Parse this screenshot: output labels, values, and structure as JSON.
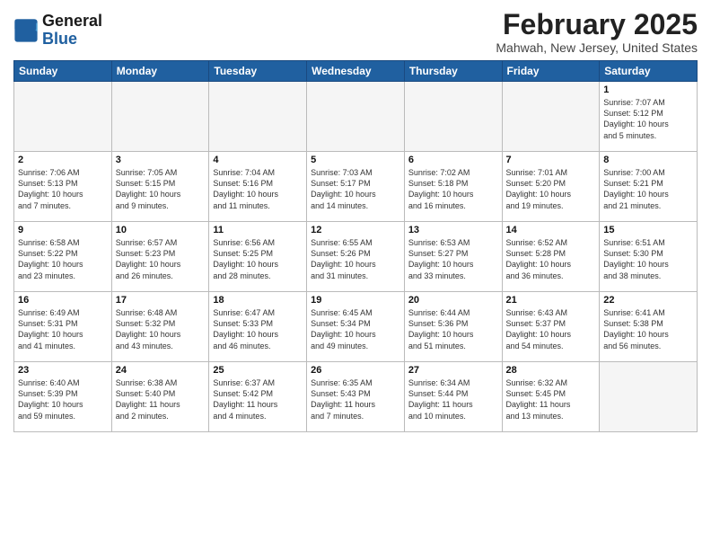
{
  "header": {
    "logo_general": "General",
    "logo_blue": "Blue",
    "title": "February 2025",
    "subtitle": "Mahwah, New Jersey, United States"
  },
  "days_of_week": [
    "Sunday",
    "Monday",
    "Tuesday",
    "Wednesday",
    "Thursday",
    "Friday",
    "Saturday"
  ],
  "weeks": [
    [
      {
        "day": "",
        "info": ""
      },
      {
        "day": "",
        "info": ""
      },
      {
        "day": "",
        "info": ""
      },
      {
        "day": "",
        "info": ""
      },
      {
        "day": "",
        "info": ""
      },
      {
        "day": "",
        "info": ""
      },
      {
        "day": "1",
        "info": "Sunrise: 7:07 AM\nSunset: 5:12 PM\nDaylight: 10 hours\nand 5 minutes."
      }
    ],
    [
      {
        "day": "2",
        "info": "Sunrise: 7:06 AM\nSunset: 5:13 PM\nDaylight: 10 hours\nand 7 minutes."
      },
      {
        "day": "3",
        "info": "Sunrise: 7:05 AM\nSunset: 5:15 PM\nDaylight: 10 hours\nand 9 minutes."
      },
      {
        "day": "4",
        "info": "Sunrise: 7:04 AM\nSunset: 5:16 PM\nDaylight: 10 hours\nand 11 minutes."
      },
      {
        "day": "5",
        "info": "Sunrise: 7:03 AM\nSunset: 5:17 PM\nDaylight: 10 hours\nand 14 minutes."
      },
      {
        "day": "6",
        "info": "Sunrise: 7:02 AM\nSunset: 5:18 PM\nDaylight: 10 hours\nand 16 minutes."
      },
      {
        "day": "7",
        "info": "Sunrise: 7:01 AM\nSunset: 5:20 PM\nDaylight: 10 hours\nand 19 minutes."
      },
      {
        "day": "8",
        "info": "Sunrise: 7:00 AM\nSunset: 5:21 PM\nDaylight: 10 hours\nand 21 minutes."
      }
    ],
    [
      {
        "day": "9",
        "info": "Sunrise: 6:58 AM\nSunset: 5:22 PM\nDaylight: 10 hours\nand 23 minutes."
      },
      {
        "day": "10",
        "info": "Sunrise: 6:57 AM\nSunset: 5:23 PM\nDaylight: 10 hours\nand 26 minutes."
      },
      {
        "day": "11",
        "info": "Sunrise: 6:56 AM\nSunset: 5:25 PM\nDaylight: 10 hours\nand 28 minutes."
      },
      {
        "day": "12",
        "info": "Sunrise: 6:55 AM\nSunset: 5:26 PM\nDaylight: 10 hours\nand 31 minutes."
      },
      {
        "day": "13",
        "info": "Sunrise: 6:53 AM\nSunset: 5:27 PM\nDaylight: 10 hours\nand 33 minutes."
      },
      {
        "day": "14",
        "info": "Sunrise: 6:52 AM\nSunset: 5:28 PM\nDaylight: 10 hours\nand 36 minutes."
      },
      {
        "day": "15",
        "info": "Sunrise: 6:51 AM\nSunset: 5:30 PM\nDaylight: 10 hours\nand 38 minutes."
      }
    ],
    [
      {
        "day": "16",
        "info": "Sunrise: 6:49 AM\nSunset: 5:31 PM\nDaylight: 10 hours\nand 41 minutes."
      },
      {
        "day": "17",
        "info": "Sunrise: 6:48 AM\nSunset: 5:32 PM\nDaylight: 10 hours\nand 43 minutes."
      },
      {
        "day": "18",
        "info": "Sunrise: 6:47 AM\nSunset: 5:33 PM\nDaylight: 10 hours\nand 46 minutes."
      },
      {
        "day": "19",
        "info": "Sunrise: 6:45 AM\nSunset: 5:34 PM\nDaylight: 10 hours\nand 49 minutes."
      },
      {
        "day": "20",
        "info": "Sunrise: 6:44 AM\nSunset: 5:36 PM\nDaylight: 10 hours\nand 51 minutes."
      },
      {
        "day": "21",
        "info": "Sunrise: 6:43 AM\nSunset: 5:37 PM\nDaylight: 10 hours\nand 54 minutes."
      },
      {
        "day": "22",
        "info": "Sunrise: 6:41 AM\nSunset: 5:38 PM\nDaylight: 10 hours\nand 56 minutes."
      }
    ],
    [
      {
        "day": "23",
        "info": "Sunrise: 6:40 AM\nSunset: 5:39 PM\nDaylight: 10 hours\nand 59 minutes."
      },
      {
        "day": "24",
        "info": "Sunrise: 6:38 AM\nSunset: 5:40 PM\nDaylight: 11 hours\nand 2 minutes."
      },
      {
        "day": "25",
        "info": "Sunrise: 6:37 AM\nSunset: 5:42 PM\nDaylight: 11 hours\nand 4 minutes."
      },
      {
        "day": "26",
        "info": "Sunrise: 6:35 AM\nSunset: 5:43 PM\nDaylight: 11 hours\nand 7 minutes."
      },
      {
        "day": "27",
        "info": "Sunrise: 6:34 AM\nSunset: 5:44 PM\nDaylight: 11 hours\nand 10 minutes."
      },
      {
        "day": "28",
        "info": "Sunrise: 6:32 AM\nSunset: 5:45 PM\nDaylight: 11 hours\nand 13 minutes."
      },
      {
        "day": "",
        "info": ""
      }
    ]
  ]
}
